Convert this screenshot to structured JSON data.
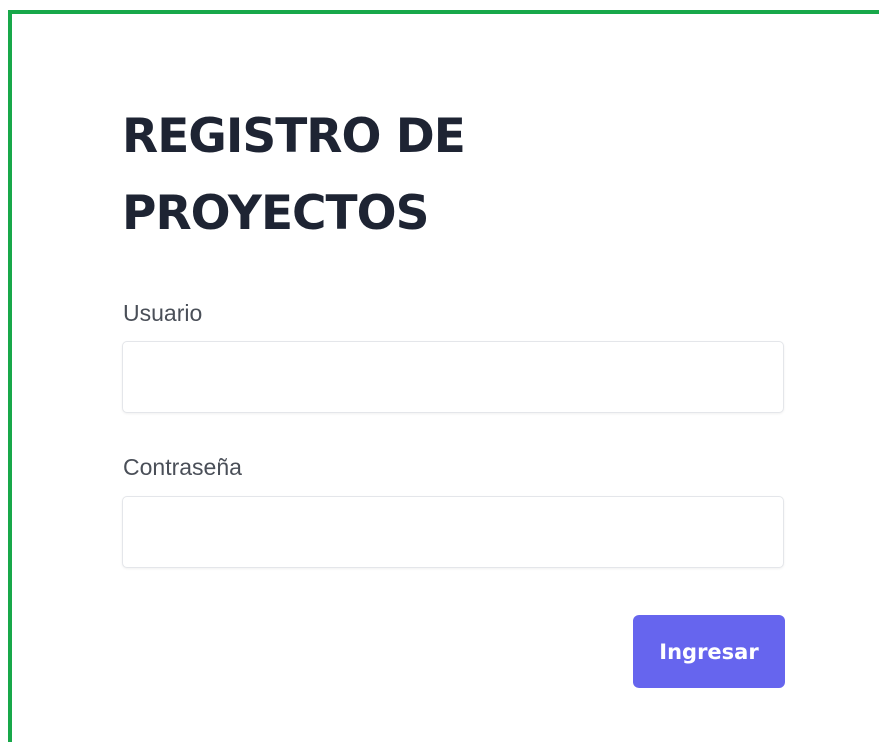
{
  "form": {
    "title": "REGISTRO DE PROYECTOS",
    "username_label": "Usuario",
    "username_value": "",
    "password_label": "Contraseña",
    "password_value": "",
    "submit_label": "Ingresar"
  },
  "colors": {
    "frame_border": "#18a84a",
    "title_text": "#1e2433",
    "label_text": "#4a4f58",
    "button_bg": "#6665ee",
    "button_text": "#ffffff",
    "input_border": "#e4e6ea"
  }
}
